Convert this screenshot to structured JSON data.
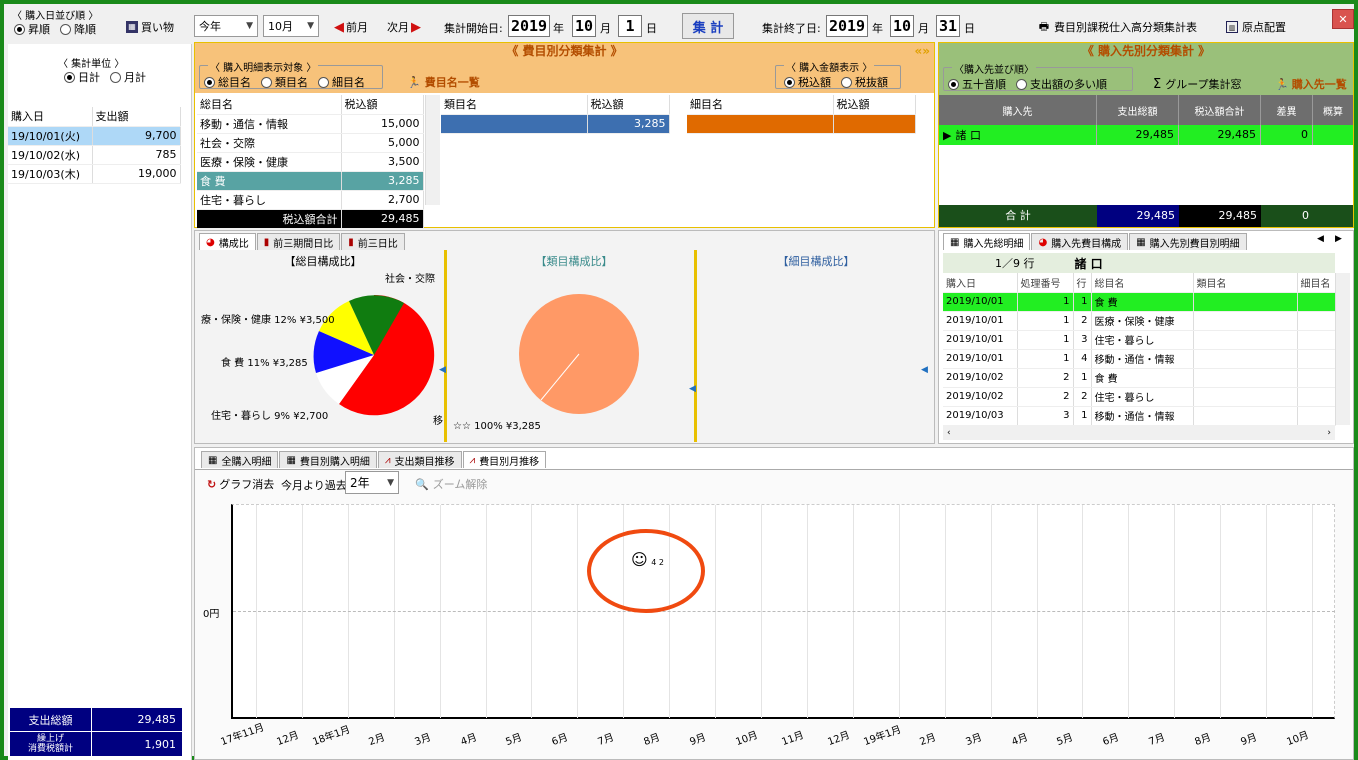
{
  "colors": {
    "frame": "#1a8a1a",
    "navy": "#000080",
    "orange_head": "#f7c27a",
    "green_head": "#9ac07a",
    "sel_blue": "#aed8f7",
    "teal": "#58a3a3",
    "bar_blue": "#3d6fb0",
    "bar_orange": "#e06a00",
    "green_row": "#22ee22",
    "pie_red": "#ff0000",
    "pie_green": "#107c10",
    "pie_yellow": "#ffff00",
    "pie_blue": "#1010ff",
    "pie_salmon": "#ff9966",
    "circle": "#f04a10"
  },
  "toolbar": {
    "sort_label": "〈 購入日並び順 〉",
    "asc": "昇順",
    "desc": "降順",
    "shopping": "買い物",
    "year_sel": "今年",
    "month_sel": "10月",
    "prev": "前月",
    "next": "次月",
    "start_label": "集計開始日:",
    "start_y": "2019",
    "start_m": "10",
    "start_d": "1",
    "nen": "年",
    "tsuki": "月",
    "hi": "日",
    "run": "集 計",
    "end_label": "集計終了日:",
    "end_y": "2019",
    "end_m": "10",
    "end_d": "31",
    "report": "費目別課税仕入高分類集計表",
    "layout": "原点配置",
    "close": "✕"
  },
  "left": {
    "unit_label": "〈 集計単位 〉",
    "daily": "日計",
    "monthly": "月計",
    "col_date": "購入日",
    "col_amt": "支出額",
    "rows": [
      {
        "date": "19/10/01(火)",
        "amt": "9,700"
      },
      {
        "date": "19/10/02(水)",
        "amt": "785"
      },
      {
        "date": "19/10/03(木)",
        "amt": "19,000"
      }
    ],
    "total_label": "支出総額",
    "total": "29,485",
    "tax_label1": "繰上げ",
    "tax_label2": "消費税額計",
    "tax": "1,901"
  },
  "himoku": {
    "title": "《 費目別分類集計 》",
    "detail_label": "〈 購入明細表示対象 〉",
    "opt1": "総目名",
    "opt2": "類目名",
    "opt3": "細目名",
    "list_btn": "費目名一覧",
    "amt_label": "〈 購入金額表示 〉",
    "tax_in": "税込額",
    "tax_out": "税抜額",
    "c1_h1": "総目名",
    "c1_h2": "税込額",
    "c1_rows": [
      {
        "n": "移動・通信・情報",
        "v": "15,000"
      },
      {
        "n": "社会・交際",
        "v": "5,000"
      },
      {
        "n": "医療・保険・健康",
        "v": "3,500"
      },
      {
        "n": "食 費",
        "v": "3,285"
      },
      {
        "n": "住宅・暮らし",
        "v": "2,700"
      }
    ],
    "c1_total_label": "税込額合計",
    "c1_total": "29,485",
    "c2_h1": "類目名",
    "c2_h2": "税込額",
    "c2_val": "3,285",
    "c3_h1": "細目名",
    "c3_h2": "税込額",
    "tabs": [
      "構成比",
      "前三期間日比",
      "前三日比"
    ],
    "pie1_title": "【総目構成比】",
    "pie2_title": "【類目構成比】",
    "pie3_title": "【細目構成比】",
    "pie1_labels": {
      "a": "社会・交際",
      "b": "療・保険・健康 12% ¥3,500",
      "c": "食 費 11% ¥3,285",
      "d": "住宅・暮らし 9% ¥2,700",
      "e": "移"
    },
    "pie2_label": "☆☆ 100% ¥3,285"
  },
  "kounyu": {
    "title": "《 購入先別分類集計 》",
    "sort_label": "〈購入先並び順〉",
    "opt1": "五十音順",
    "opt2": "支出額の多い順",
    "group_btn": "グループ集計窓",
    "list_btn": "購入先一覧",
    "h1": "購入先",
    "h2": "支出総額",
    "h3": "税込額合計",
    "h4": "差異",
    "h5": "概算",
    "row": {
      "n": "諸 口",
      "v1": "29,485",
      "v2": "29,485",
      "v3": "0"
    },
    "total_label": "合 計",
    "t1": "29,485",
    "t2": "29,485",
    "t3": "0",
    "tabs": [
      "購入先総明細",
      "購入先費目構成",
      "購入先別費目別明細"
    ],
    "pager": "1／9 行",
    "pager_name": "諸 口",
    "d_h": [
      "購入日",
      "処理番号",
      "行",
      "総目名",
      "類目名",
      "細目名"
    ],
    "d_rows": [
      {
        "d": "2019/10/01",
        "no": "1",
        "ln": "1",
        "n": "食 費"
      },
      {
        "d": "2019/10/01",
        "no": "1",
        "ln": "2",
        "n": "医療・保険・健康"
      },
      {
        "d": "2019/10/01",
        "no": "1",
        "ln": "3",
        "n": "住宅・暮らし"
      },
      {
        "d": "2019/10/01",
        "no": "1",
        "ln": "4",
        "n": "移動・通信・情報"
      },
      {
        "d": "2019/10/02",
        "no": "2",
        "ln": "1",
        "n": "食 費"
      },
      {
        "d": "2019/10/02",
        "no": "2",
        "ln": "2",
        "n": "住宅・暮らし"
      },
      {
        "d": "2019/10/03",
        "no": "3",
        "ln": "1",
        "n": "移動・通信・情報"
      }
    ]
  },
  "bottom": {
    "tabs": [
      "全購入明細",
      "費目別購入明細",
      "支出類目推移",
      "費目別月推移"
    ],
    "clear": "グラフ消去",
    "past_label": "今月より過去",
    "past_sel": "2年",
    "zoom": "ズーム解除",
    "y_zero": "0円",
    "marker": "4 2",
    "months": [
      "17年11月",
      "12月",
      "18年1月",
      "2月",
      "3月",
      "4月",
      "5月",
      "6月",
      "7月",
      "8月",
      "9月",
      "10月",
      "11月",
      "12月",
      "19年1月",
      "2月",
      "3月",
      "4月",
      "5月",
      "6月",
      "7月",
      "8月",
      "9月",
      "10月"
    ]
  }
}
